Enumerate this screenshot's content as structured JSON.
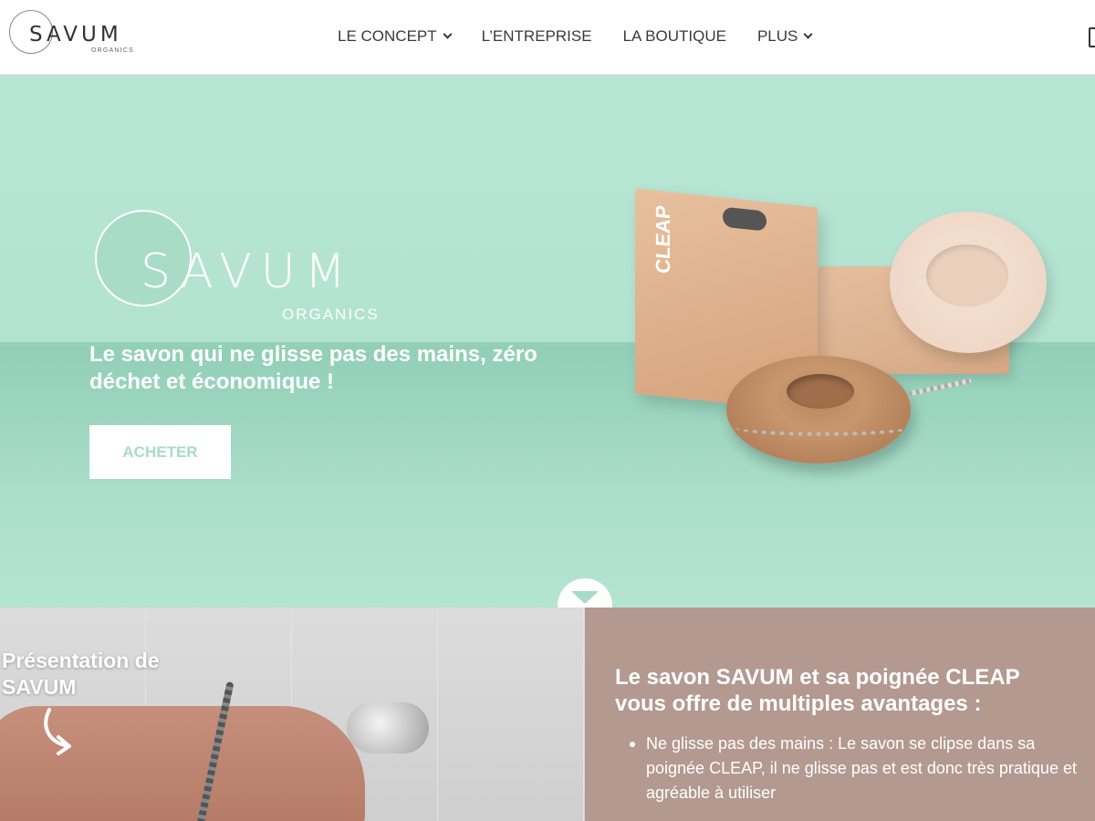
{
  "header": {
    "logo_word": "SAVUM",
    "logo_sub": "ORGANICS",
    "nav": [
      {
        "label": "LE CONCEPT",
        "dropdown": true
      },
      {
        "label": "L’ENTREPRISE",
        "dropdown": false
      },
      {
        "label": "LA BOUTIQUE",
        "dropdown": false
      },
      {
        "label": "PLUS",
        "dropdown": true
      }
    ],
    "cart_icon": "cart-icon"
  },
  "hero": {
    "logo_word": "SAVUM",
    "logo_sub": "ORGANICS",
    "tagline": "Le savon qui ne glisse pas des mains, zéro déchet et économique !",
    "cta_label": "ACHETER",
    "product_label": "CLEAP",
    "scroll_icon": "chevron-down-icon",
    "colors": {
      "background": "#b2e3d0",
      "accent": "#a6dcc6"
    }
  },
  "video": {
    "title": "Présentation de SAVUM",
    "arrow_icon": "curved-arrow-icon"
  },
  "info": {
    "title": "Le savon SAVUM et sa poignée CLEAP vous offre de multiples avantages :",
    "items": [
      "Ne glisse pas des mains : Le savon se clipse dans sa poignée CLEAP, il ne glisse pas et est donc très pratique et agréable à utiliser"
    ],
    "background": "#b39990"
  }
}
